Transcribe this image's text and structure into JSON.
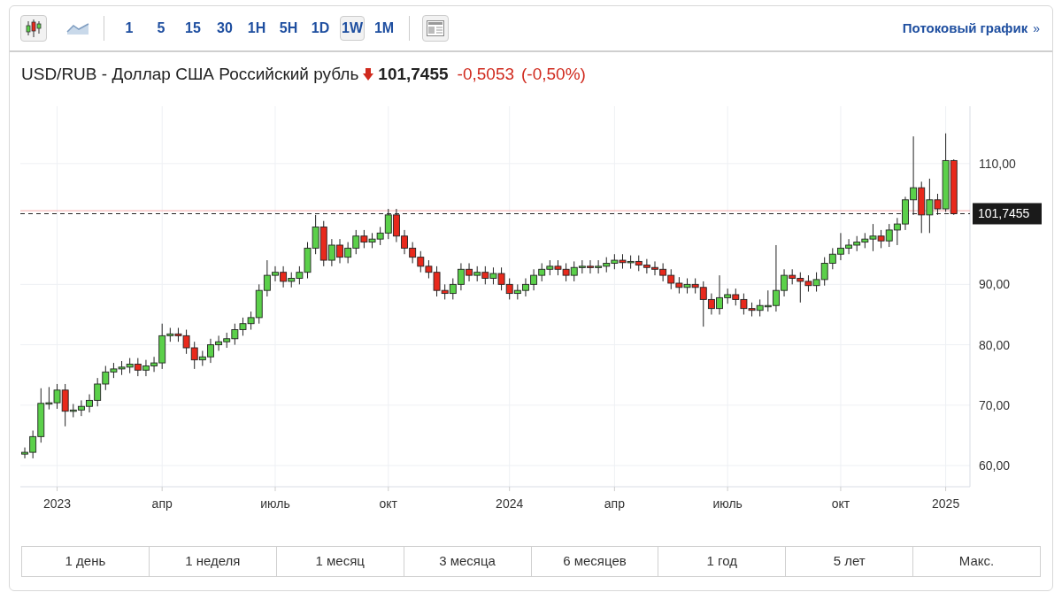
{
  "toolbar": {
    "chart_types": [
      {
        "kind": "candles",
        "selected": true
      },
      {
        "kind": "area",
        "selected": false
      }
    ],
    "intervals": [
      {
        "label": "1",
        "selected": false
      },
      {
        "label": "5",
        "selected": false
      },
      {
        "label": "15",
        "selected": false
      },
      {
        "label": "30",
        "selected": false
      },
      {
        "label": "1H",
        "selected": false
      },
      {
        "label": "5H",
        "selected": false
      },
      {
        "label": "1D",
        "selected": false
      },
      {
        "label": "1W",
        "selected": true
      },
      {
        "label": "1M",
        "selected": false
      }
    ],
    "link": {
      "label": "Потоковый график",
      "arrow": "»"
    }
  },
  "quote": {
    "title": "USD/RUB - Доллар США Российский рубль",
    "falling": true,
    "price": "101,7455",
    "change": "-0,5053",
    "change_percent": "(-0,50%)"
  },
  "chart_data": {
    "type": "candlestick",
    "grid": true,
    "ylim": [
      56.5,
      119.5
    ],
    "categories": [
      null,
      null,
      null,
      null,
      "2023",
      null,
      null,
      null,
      null,
      null,
      null,
      null,
      null,
      null,
      null,
      null,
      null,
      "апр",
      null,
      null,
      null,
      null,
      null,
      null,
      null,
      null,
      null,
      null,
      null,
      null,
      null,
      "июль",
      null,
      null,
      null,
      null,
      null,
      null,
      null,
      null,
      null,
      null,
      null,
      null,
      null,
      "окт",
      null,
      null,
      null,
      null,
      null,
      null,
      null,
      null,
      null,
      null,
      null,
      null,
      null,
      null,
      "2024",
      null,
      null,
      null,
      null,
      null,
      null,
      null,
      null,
      null,
      null,
      null,
      null,
      "апр",
      null,
      null,
      null,
      null,
      null,
      null,
      null,
      null,
      null,
      null,
      null,
      null,
      null,
      "июль",
      null,
      null,
      null,
      null,
      null,
      null,
      null,
      null,
      null,
      null,
      null,
      null,
      null,
      "окт",
      null,
      null,
      null,
      null,
      null,
      null,
      null,
      null,
      null,
      null,
      null,
      null,
      "2025",
      null
    ],
    "yticks": [
      {
        "value": 60,
        "label": "60,00"
      },
      {
        "value": 70,
        "label": "70,00"
      },
      {
        "value": 80,
        "label": "80,00"
      },
      {
        "value": 90,
        "label": "90,00"
      },
      {
        "value": 110,
        "label": "110,00"
      }
    ],
    "ohlc": [
      [
        61.9,
        63,
        61.2,
        62.2
      ],
      [
        62.2,
        65.8,
        61.2,
        64.8
      ],
      [
        64.8,
        72.8,
        63.8,
        70.3
      ],
      [
        70.3,
        73,
        69.3,
        70.4
      ],
      [
        70.4,
        73.5,
        69.4,
        72.5
      ],
      [
        72.5,
        73.5,
        66.5,
        69
      ],
      [
        69,
        70.2,
        68,
        69.2
      ],
      [
        69.2,
        70.8,
        68.2,
        69.8
      ],
      [
        69.8,
        71.8,
        68.8,
        70.8
      ],
      [
        70.8,
        74.5,
        69.8,
        73.5
      ],
      [
        73.5,
        76.5,
        72.5,
        75.5
      ],
      [
        75.5,
        77,
        74.5,
        76
      ],
      [
        76,
        77.3,
        75,
        76.3
      ],
      [
        76.3,
        77.8,
        75.3,
        76.8
      ],
      [
        76.8,
        77.8,
        74.8,
        75.8
      ],
      [
        75.8,
        77.5,
        74.8,
        76.5
      ],
      [
        76.5,
        78,
        75.5,
        77
      ],
      [
        77,
        83.5,
        76,
        81.5
      ],
      [
        81.5,
        82.8,
        80.5,
        81.8
      ],
      [
        81.8,
        82.8,
        80.5,
        81.5
      ],
      [
        81.5,
        82.5,
        78.5,
        79.5
      ],
      [
        79.5,
        80.5,
        76,
        77.5
      ],
      [
        77.5,
        79,
        76.5,
        78
      ],
      [
        78,
        81,
        77,
        80
      ],
      [
        80,
        81.5,
        79,
        80.5
      ],
      [
        80.5,
        82,
        79.5,
        81
      ],
      [
        81,
        83.5,
        80,
        82.5
      ],
      [
        82.5,
        84.5,
        81.5,
        83.5
      ],
      [
        83.5,
        85.5,
        82.5,
        84.5
      ],
      [
        84.5,
        90,
        83.5,
        89
      ],
      [
        89,
        94,
        88,
        91.5
      ],
      [
        91.5,
        93,
        90.5,
        92
      ],
      [
        92,
        93,
        89.5,
        90.5
      ],
      [
        90.5,
        92,
        89.5,
        91
      ],
      [
        91,
        93,
        90,
        92
      ],
      [
        92,
        97,
        91,
        96
      ],
      [
        96,
        101.5,
        95,
        99.5
      ],
      [
        99.5,
        100.5,
        93,
        94
      ],
      [
        94,
        97.5,
        93,
        96.5
      ],
      [
        96.5,
        97.5,
        93.5,
        94.5
      ],
      [
        94.5,
        97,
        93.5,
        96
      ],
      [
        96,
        99,
        95,
        98
      ],
      [
        98,
        99,
        96,
        97
      ],
      [
        97,
        98.5,
        96,
        97.5
      ],
      [
        97.5,
        99.5,
        96.5,
        98.5
      ],
      [
        98.5,
        102.5,
        97.5,
        101.5
      ],
      [
        101.5,
        102.5,
        97,
        98
      ],
      [
        98,
        99,
        95,
        96
      ],
      [
        96,
        97,
        93.5,
        94.5
      ],
      [
        94.5,
        95.5,
        92,
        93
      ],
      [
        93,
        94,
        91,
        92
      ],
      [
        92,
        93,
        88,
        89
      ],
      [
        89,
        90,
        87.5,
        88.5
      ],
      [
        88.5,
        91,
        87.5,
        90
      ],
      [
        90,
        93.5,
        89,
        92.5
      ],
      [
        92.5,
        93.5,
        90.5,
        91.5
      ],
      [
        91.5,
        93,
        90.5,
        92
      ],
      [
        92,
        93,
        90,
        91
      ],
      [
        91,
        92.8,
        90,
        91.8
      ],
      [
        91.8,
        92.8,
        89,
        90
      ],
      [
        90,
        91,
        87.5,
        88.5
      ],
      [
        88.5,
        90,
        87.5,
        89
      ],
      [
        89,
        91,
        88,
        90
      ],
      [
        90,
        92.5,
        89,
        91.5
      ],
      [
        91.5,
        93.5,
        90.5,
        92.5
      ],
      [
        92.5,
        94,
        91.5,
        93
      ],
      [
        93,
        94,
        91.5,
        92.5
      ],
      [
        92.5,
        93.5,
        90.5,
        91.5
      ],
      [
        91.5,
        93.8,
        90.5,
        92.8
      ],
      [
        92.8,
        94,
        91.8,
        93
      ],
      [
        93,
        94,
        91.8,
        92.8
      ],
      [
        92.8,
        94,
        91.8,
        93
      ],
      [
        93,
        94.5,
        92,
        93.5
      ],
      [
        93.5,
        95,
        92.5,
        94
      ],
      [
        94,
        95,
        92.6,
        93.6
      ],
      [
        93.6,
        94.8,
        92.6,
        93.8
      ],
      [
        93.8,
        94.8,
        92.2,
        93.2
      ],
      [
        93.2,
        94.2,
        91.8,
        92.8
      ],
      [
        92.8,
        93.8,
        91.5,
        92.5
      ],
      [
        92.5,
        93.5,
        90.5,
        91.5
      ],
      [
        91.5,
        92.5,
        89.2,
        90.2
      ],
      [
        90.2,
        91.2,
        88.5,
        89.5
      ],
      [
        89.5,
        91,
        88.5,
        90
      ],
      [
        90,
        91,
        88.5,
        89.5
      ],
      [
        89.5,
        90.5,
        83,
        87.5
      ],
      [
        87.5,
        88.5,
        85,
        86
      ],
      [
        86,
        91.5,
        85,
        87.8
      ],
      [
        87.8,
        89.3,
        86.8,
        88.3
      ],
      [
        88.3,
        89.3,
        86.5,
        87.5
      ],
      [
        87.5,
        88.5,
        85,
        86
      ],
      [
        86,
        87,
        84.7,
        85.7
      ],
      [
        85.7,
        87.5,
        84.7,
        86.5
      ],
      [
        86.5,
        89,
        85.5,
        86.5
      ],
      [
        86.5,
        96.5,
        85.5,
        89
      ],
      [
        89,
        92.5,
        88,
        91.5
      ],
      [
        91.5,
        92.5,
        90,
        91
      ],
      [
        91,
        92,
        87,
        90.5
      ],
      [
        90.5,
        91.5,
        88.8,
        89.8
      ],
      [
        89.8,
        92,
        88.8,
        90.8
      ],
      [
        90.8,
        94.5,
        89.8,
        93.5
      ],
      [
        93.5,
        96,
        92.5,
        95
      ],
      [
        95,
        98.5,
        94,
        96
      ],
      [
        96,
        97.5,
        95,
        96.5
      ],
      [
        96.5,
        98,
        95.5,
        97
      ],
      [
        97,
        98.5,
        96,
        97.5
      ],
      [
        97.5,
        100,
        95.5,
        98
      ],
      [
        98,
        99,
        96,
        97.2
      ],
      [
        97.2,
        100,
        96.2,
        99
      ],
      [
        99,
        101,
        96.5,
        100
      ],
      [
        100,
        104.5,
        99,
        104
      ],
      [
        104,
        114.5,
        101.5,
        106
      ],
      [
        106,
        107,
        98.5,
        101.5
      ],
      [
        101.5,
        107.5,
        98.5,
        104
      ],
      [
        104,
        105,
        101.5,
        102.5
      ],
      [
        102.5,
        115,
        102,
        110.5
      ],
      [
        110.5,
        110.7,
        101.5,
        101.7
      ]
    ],
    "ref_lines": [
      {
        "axis": "y",
        "value": 102.2,
        "color": "#f4a9a9"
      },
      {
        "axis": "y",
        "value": 101.7,
        "color": "#222222",
        "label": "101,7455"
      }
    ]
  },
  "ranges": [
    {
      "label": "1 день"
    },
    {
      "label": "1 неделя"
    },
    {
      "label": "1 месяц"
    },
    {
      "label": "3 месяца"
    },
    {
      "label": "6 месяцев"
    },
    {
      "label": "1 год"
    },
    {
      "label": "5 лет"
    },
    {
      "label": "Макс."
    }
  ]
}
